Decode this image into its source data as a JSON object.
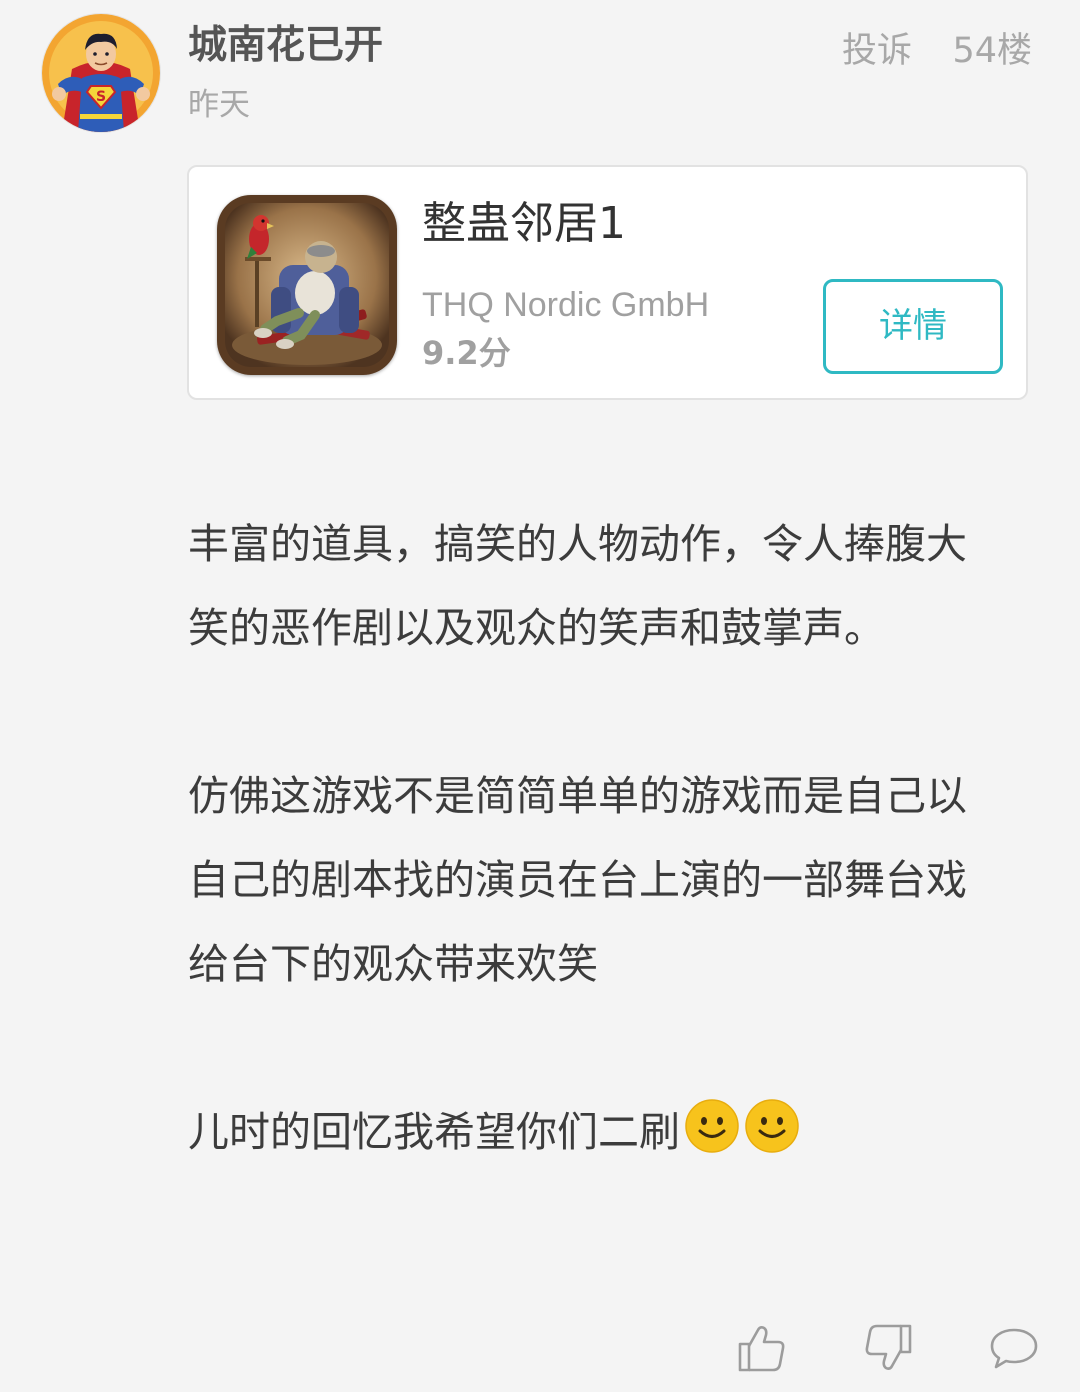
{
  "comment": {
    "username": "城南花已开",
    "time": "昨天",
    "report_label": "投诉",
    "floor": "54楼",
    "avatar_icon": "superman-avatar"
  },
  "app_card": {
    "name": "整蛊邻居1",
    "developer": "THQ Nordic GmbH",
    "rating": "9.2分",
    "detail_button": "详情",
    "icon": "neighbours-game-icon",
    "accent_color": "#2fb9c3"
  },
  "review": {
    "paragraphs": [
      "丰富的道具，搞笑的人物动作，令人捧腹大笑的恶作剧以及观众的笑声和鼓掌声。",
      "仿佛这游戏不是简简单单的游戏而是自己以自己的剧本找的演员在台上演的一部舞台戏给台下的观众带来欢笑",
      "儿时的回忆我希望你们二刷"
    ],
    "trailing_emoji": [
      "smiley-emoji",
      "smiley-emoji"
    ]
  },
  "actions": [
    {
      "icon": "thumbs-up-icon"
    },
    {
      "icon": "thumbs-down-icon"
    },
    {
      "icon": "comment-icon"
    }
  ]
}
